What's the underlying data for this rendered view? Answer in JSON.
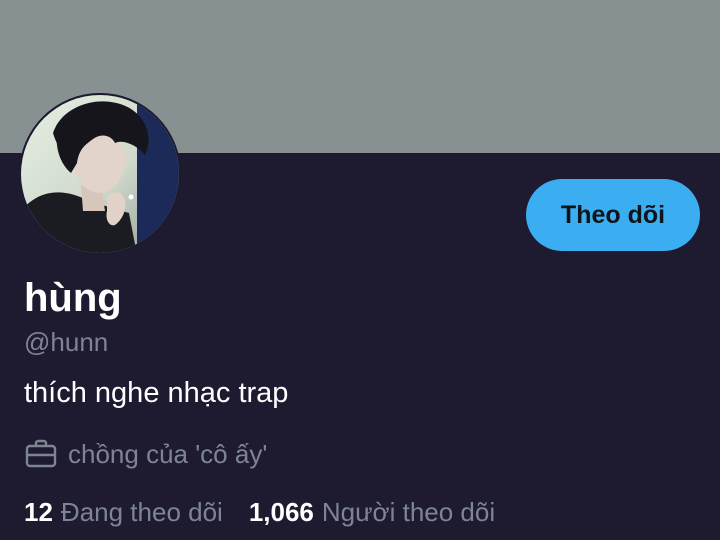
{
  "profile": {
    "display_name": "hùng",
    "handle": "@hunn",
    "bio": "thích nghe nhạc trap",
    "work": "chồng của 'cô ấy'",
    "icons": {
      "work": "briefcase-icon"
    }
  },
  "actions": {
    "follow_label": "Theo dõi"
  },
  "stats": {
    "following_count": "12",
    "following_label": "Đang theo dõi",
    "followers_count": "1,066",
    "followers_label": "Người theo dõi"
  },
  "colors": {
    "banner": "#879192",
    "background": "#1e1a30",
    "accent": "#3aaef0",
    "secondary_text": "#7d8591",
    "primary_text": "#ffffff"
  }
}
